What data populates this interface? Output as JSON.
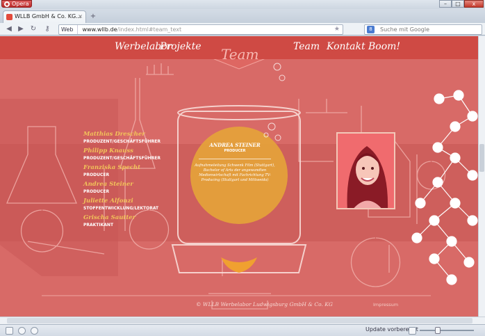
{
  "browser": {
    "menu_label": "Opera",
    "tab_title": "WLLB GmbH & Co. KG...",
    "tab_close": "×",
    "new_tab": "+",
    "window_controls": [
      "–",
      "□",
      "x"
    ],
    "address": {
      "mode": "Web",
      "domain": "www.wllb.de",
      "path": "/index.html#team_text"
    },
    "search_placeholder": "Suche mit Google",
    "status_text": "Update vorbereitet"
  },
  "site": {
    "nav_left": [
      "Werbelabor",
      "Projekte"
    ],
    "nav_center": "Team",
    "nav_right": [
      "Team",
      "Kontakt",
      "Boom!"
    ],
    "team": [
      {
        "name": "Matthias Drescher",
        "role": "PRODUZENT/GESCHÄFTSFÜHRER"
      },
      {
        "name": "Philipp Knauss",
        "role": "PRODUZENT/GESCHÄFTSFÜHRER"
      },
      {
        "name": "Franziska Specht",
        "role": "PRODUCER"
      },
      {
        "name": "Andrea Steiner",
        "role": "PRODUCER"
      },
      {
        "name": "Juliette Alfonzi",
        "role": "STOFFENTWICKLUNG/LEKTORAT"
      },
      {
        "name": "Grischa Sautter",
        "role": "PRAKTIKANT"
      }
    ],
    "bio": {
      "name": "ANDREA STEINER",
      "role": "PRODUCER",
      "text": "Aufnahmeleitung Schwenk Film (Stuttgart), Bachelor of Arts der angewandten Medienwirtschaft mit Fachrichtung TV-Producing (Stuttgart und Mittweida)"
    },
    "footer": {
      "copyright": "© WLLB Werbelabor Ludwigsburg GmbH & Co. KG",
      "imprint": "Impressum"
    }
  },
  "colors": {
    "accent": "#d86a67",
    "nav_red": "#cf4a44",
    "gold": "#f2c35a",
    "orb": "#e5a33a"
  }
}
